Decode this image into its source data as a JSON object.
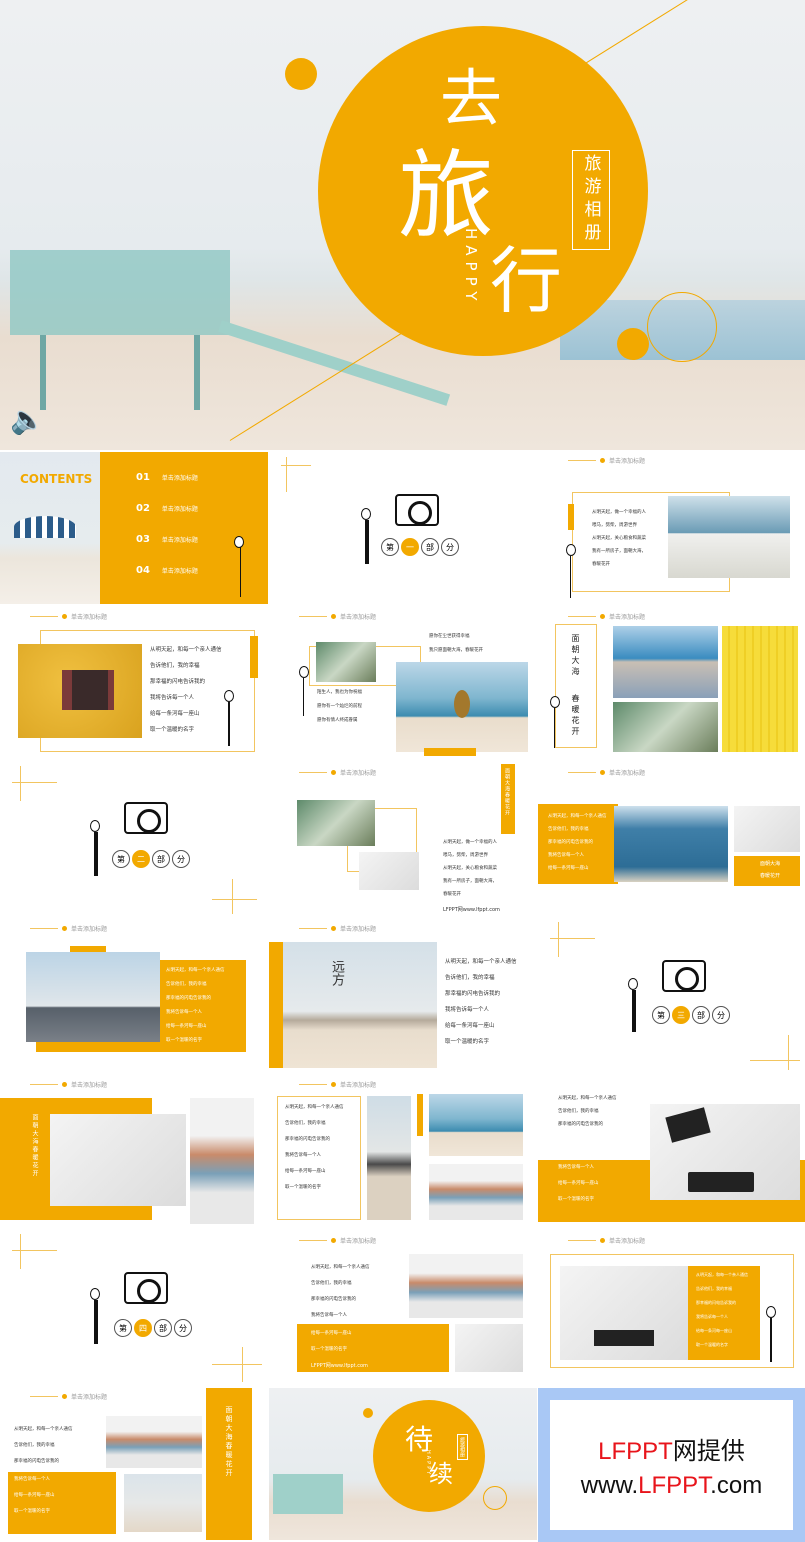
{
  "hero": {
    "char1": "去",
    "char2": "旅",
    "char3": "行",
    "happy": "HAPPY",
    "subtitle": "旅游相册",
    "speaker_icon": "speaker-icon"
  },
  "colors": {
    "accent": "#f2a900",
    "ad_red": "#e8141b",
    "ad_border": "#a9c8f5"
  },
  "header_label": "单击添加标题",
  "contents": {
    "title": "CONTENTS",
    "items": [
      {
        "num": "01",
        "label": "单击添加标题"
      },
      {
        "num": "02",
        "label": "单击添加标题"
      },
      {
        "num": "03",
        "label": "单击添加标题"
      },
      {
        "num": "04",
        "label": "单击添加标题"
      }
    ]
  },
  "sections": [
    [
      "第",
      "一",
      "部",
      "分"
    ],
    [
      "第",
      "二",
      "部",
      "分"
    ],
    [
      "第",
      "三",
      "部",
      "分"
    ],
    [
      "第",
      "四",
      "部",
      "分"
    ]
  ],
  "poem_a": [
    "从明天起，做一个幸福的人",
    "喂马，劈柴，周游世界",
    "从明天起，关心粮食和蔬菜",
    "我有一所房子，面朝大海，",
    "春暖花开"
  ],
  "poem_b": [
    "从明天起，和每一个亲人通信",
    "告诉他们，我的幸福",
    "那幸福的闪电告诉我的",
    "我将告诉每一个人",
    "给每一条河每一座山",
    "取一个温暖的名字"
  ],
  "poem_c": [
    "陌生人，我也为你祝福",
    "愿你有一个灿烂的前程",
    "愿你有情人终成眷属"
  ],
  "poem_d": [
    "愿你在尘世获得幸福",
    "我只愿面朝大海，春暖花开"
  ],
  "vertical": {
    "a": "面朝大海",
    "b": "春暖花开",
    "c": "面朝大海春暖花开"
  },
  "yuanfang": "远方",
  "watermark": "LFPPT网www.lfppt.com",
  "end": {
    "title1": "待",
    "title2": "续",
    "subtitle": "旅游相册",
    "happy": "HAPPY"
  },
  "ad": {
    "line1_red": "LFPPT",
    "line1_black": "网提供",
    "line2_a": "www.",
    "line2_red": "LFPPT",
    "line2_b": ".com"
  }
}
